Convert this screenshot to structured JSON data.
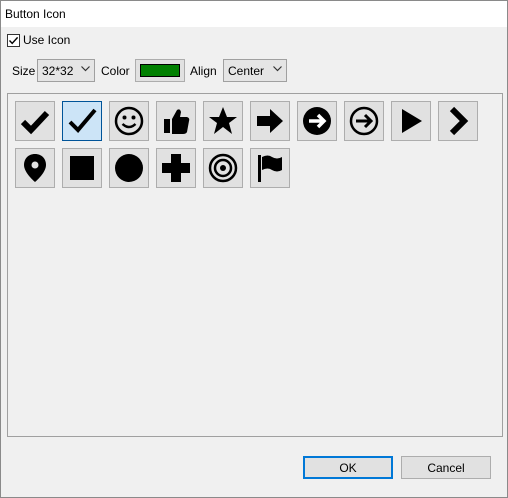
{
  "window": {
    "title": "Button Icon"
  },
  "use_icon": {
    "label": "Use Icon",
    "checked": true
  },
  "size": {
    "label": "Size",
    "value": "32*32"
  },
  "color": {
    "label": "Color",
    "value": "#008000"
  },
  "align": {
    "label": "Align",
    "value": "Center"
  },
  "icons": [
    {
      "name": "check-bold-icon",
      "selected": false
    },
    {
      "name": "check-icon",
      "selected": true
    },
    {
      "name": "smiley-icon",
      "selected": false
    },
    {
      "name": "thumbs-up-icon",
      "selected": false
    },
    {
      "name": "star-icon",
      "selected": false
    },
    {
      "name": "arrow-right-icon",
      "selected": false
    },
    {
      "name": "arrow-right-circle-icon",
      "selected": false
    },
    {
      "name": "arrow-right-circle-outline-icon",
      "selected": false
    },
    {
      "name": "play-icon",
      "selected": false
    },
    {
      "name": "chevron-right-icon",
      "selected": false
    },
    {
      "name": "map-pin-icon",
      "selected": false
    },
    {
      "name": "square-icon",
      "selected": false
    },
    {
      "name": "circle-icon",
      "selected": false
    },
    {
      "name": "plus-icon",
      "selected": false
    },
    {
      "name": "target-icon",
      "selected": false
    },
    {
      "name": "flag-icon",
      "selected": false
    }
  ],
  "buttons": {
    "ok": "OK",
    "cancel": "Cancel"
  }
}
